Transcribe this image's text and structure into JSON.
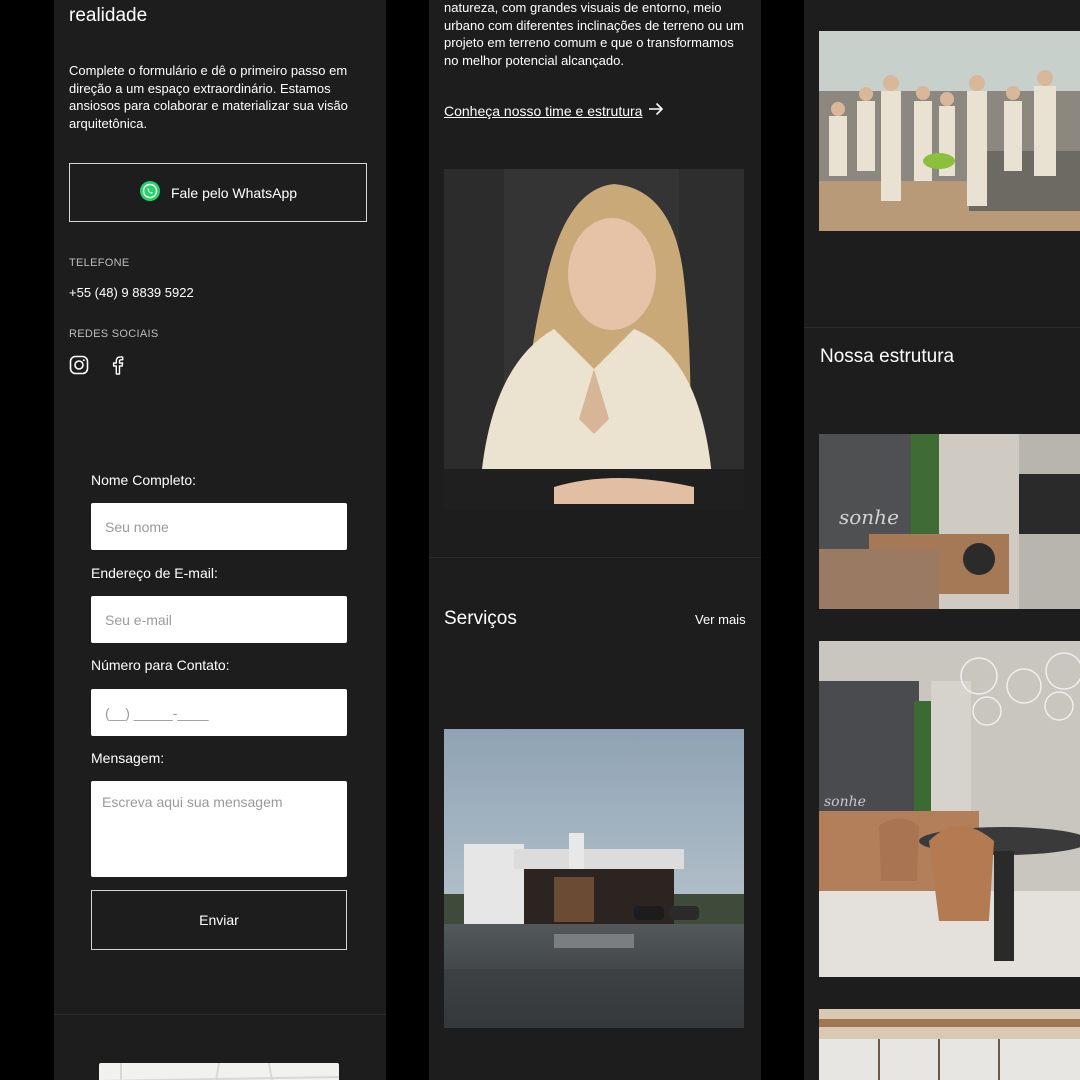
{
  "contact": {
    "heading_tail": "realidade",
    "intro": "Complete o formulário e dê o primeiro passo em direção a um espaço extraordinário. Estamos ansiosos para colaborar e materializar sua visão arquitetônica.",
    "whatsapp_label": "Fale pelo WhatsApp",
    "phone_label": "TELEFONE",
    "phone_value": "+55 (48) 9 8839 5922",
    "social_label": "REDES SOCIAIS",
    "social_icons": [
      "instagram-icon",
      "facebook-icon"
    ]
  },
  "form": {
    "name_label": "Nome Completo:",
    "name_placeholder": "Seu nome",
    "email_label": "Endereço de E-mail:",
    "email_placeholder": "Seu e-mail",
    "phone_label": "Número para Contato:",
    "phone_placeholder": "(__) _____-____",
    "message_label": "Mensagem:",
    "message_placeholder": "Escreva aqui sua mensagem",
    "submit_label": "Enviar"
  },
  "about": {
    "text": "natureza, com grandes visuais de entorno, meio urbano com diferentes inclinações de terreno ou um projeto em terreno comum e que o transformamos no melhor potencial alcançado.",
    "team_link": "Conheça nosso time e estrutura"
  },
  "services": {
    "title": "Serviços",
    "more_link": "Ver mais"
  },
  "structure": {
    "title": "Nossa estrutura"
  },
  "colors": {
    "panel_bg": "#1d1d1d",
    "page_bg": "#000000",
    "whatsapp_green": "#25d366"
  }
}
